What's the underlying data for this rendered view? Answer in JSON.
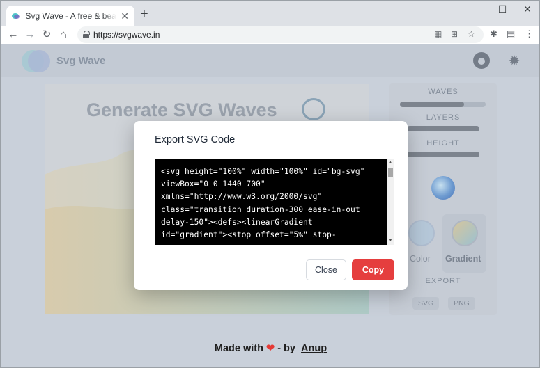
{
  "browser": {
    "tab_title": "Svg Wave - A free & beautiful gradient SVG wave generator",
    "tab_close": "✕",
    "new_tab": "+",
    "window_controls": {
      "minimize": "—",
      "maximize": "☐",
      "close": "✕"
    },
    "nav": {
      "back": "←",
      "forward": "→",
      "reload": "↻",
      "home": "⌂"
    },
    "url": "https://svgwave.in"
  },
  "site": {
    "brand": "Svg Wave",
    "hero_title": "Generate SVG Waves",
    "colors": {
      "accent": "#e53e3e",
      "heart": "#e53935"
    }
  },
  "panel": {
    "waves_label": "WAVES",
    "layers_label": "LAYERS",
    "height_label": "HEIGHT",
    "color_label": "Color",
    "gradient_label": "Gradient",
    "export_label": "EXPORT",
    "svg_label": "SVG",
    "png_label": "PNG",
    "waves_level": 0.75,
    "layers_level": 1.0,
    "height_level": 1.0
  },
  "footer": {
    "made_with": "Made with",
    "heart": "❤",
    "by": "- by",
    "author": "Anup"
  },
  "modal": {
    "title": "Export SVG Code",
    "code": "<svg height=\"100%\" width=\"100%\" id=\"bg-svg\" viewBox=\"0 0 1440 700\" xmlns=\"http://www.w3.org/2000/svg\" class=\"transition duration-300 ease-in-out delay-150\"><defs><linearGradient id=\"gradient\"><stop offset=\"5%\" stop-",
    "close_label": "Close",
    "copy_label": "Copy"
  }
}
